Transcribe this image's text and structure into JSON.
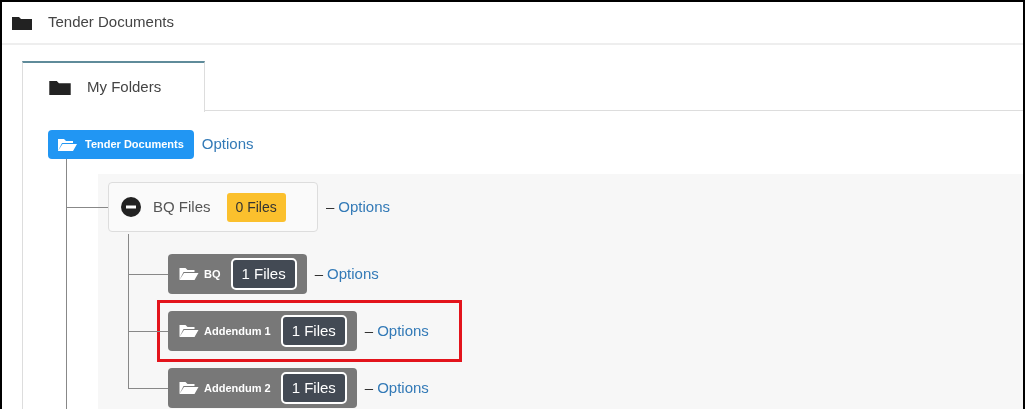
{
  "header": {
    "title": "Tender Documents"
  },
  "tabs": [
    {
      "label": "My Folders",
      "selected": true
    }
  ],
  "tree": {
    "root": {
      "label": "Tender Documents",
      "options": "Options"
    },
    "children": [
      {
        "label": "BQ Files",
        "count": "0 Files",
        "dash": "–",
        "options": "Options",
        "expanded": true,
        "children": [
          {
            "label": "BQ",
            "count": "1 Files",
            "dash": "–",
            "options": "Options",
            "highlighted": false
          },
          {
            "label": "Addendum 1",
            "count": "1 Files",
            "dash": "–",
            "options": "Options",
            "highlighted": true
          },
          {
            "label": "Addendum 2",
            "count": "1 Files",
            "dash": "–",
            "options": "Options",
            "highlighted": false
          }
        ]
      }
    ]
  }
}
